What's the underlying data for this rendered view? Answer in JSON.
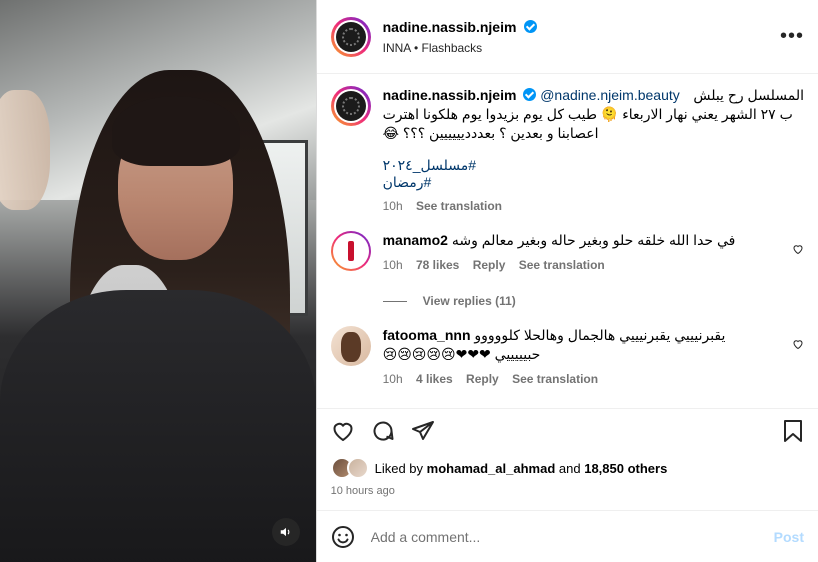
{
  "post": {
    "username": "nadine.nassib.njeim",
    "audio": "INNA • Flashbacks",
    "more_label": "•••"
  },
  "caption": {
    "username": "nadine.nassib.njeim",
    "mention": "@nadine.njeim.beauty",
    "line1": "المسلسل رح يبلش",
    "line2": "ب ٢٧ الشهر يعني نهار الاربعاء 🫠 طيب كل يوم بزيدوا يوم هلكونا اهترت",
    "line3": "اعصابنا و بعدين ؟ بعددديييييين ؟؟؟ 😂",
    "tags": "#مسلسل_٢٠٢٤ #رمضان",
    "time": "10h",
    "see_translation": "See translation"
  },
  "comments": [
    {
      "username": "manamo2",
      "text": "في حدا الله خلقه حلو وبغير حاله وبغير معالم وشه",
      "time": "10h",
      "likes": "78 likes",
      "reply": "Reply",
      "see_translation": "See translation",
      "view_replies": "View replies (11)"
    },
    {
      "username": "fatooma_nnn",
      "text": "يقبرنيييي يقبرنيييي هالجمال وهالحلا كلووووو",
      "text2": "حبيييييي ❤❤❤😢😢😢😢😢",
      "time": "10h",
      "likes": "4 likes",
      "reply": "Reply",
      "see_translation": "See translation"
    }
  ],
  "likes": {
    "prefix": "Liked by",
    "user": "mohamad_al_ahmad",
    "and": "and",
    "others": "18,850 others"
  },
  "timestamp": "10 hours ago",
  "add_comment": {
    "placeholder": "Add a comment...",
    "post_label": "Post"
  },
  "colors": {
    "link": "#00376b",
    "verified": "#0095f6",
    "post_disabled": "#b3dbff",
    "meta": "#737373"
  },
  "icons": [
    "more-icon",
    "verified-icon",
    "heart-icon",
    "comment-icon",
    "share-icon",
    "bookmark-icon",
    "emoji-icon",
    "mute-icon"
  ]
}
